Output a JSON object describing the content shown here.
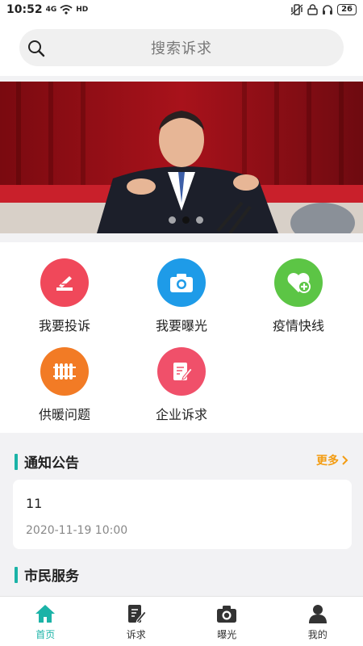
{
  "status_bar": {
    "time": "10:52",
    "network": "4G",
    "hd": "HD",
    "battery": "26"
  },
  "search": {
    "placeholder": "搜索诉求"
  },
  "banner": {
    "dots": 3,
    "active_dot": 1
  },
  "menu": [
    {
      "label": "我要投诉",
      "icon": "complaint-icon",
      "color": "#f0485a"
    },
    {
      "label": "我要曝光",
      "icon": "camera-icon",
      "color": "#1e9be8"
    },
    {
      "label": "疫情快线",
      "icon": "heart-plus-icon",
      "color": "#5cc545"
    },
    {
      "label": "供暖问题",
      "icon": "radiator-icon",
      "color": "#f27b25"
    },
    {
      "label": "企业诉求",
      "icon": "edit-icon",
      "color": "#f0506a"
    }
  ],
  "notice": {
    "section_title": "通知公告",
    "more_label": "更多",
    "items": [
      {
        "title": "11",
        "time": "2020-11-19 10:00"
      }
    ]
  },
  "services": {
    "section_title": "市民服务"
  },
  "tabs": [
    {
      "label": "首页",
      "icon": "home-icon",
      "active": true
    },
    {
      "label": "诉求",
      "icon": "edit-doc-icon",
      "active": false
    },
    {
      "label": "曝光",
      "icon": "camera-icon",
      "active": false
    },
    {
      "label": "我的",
      "icon": "user-icon",
      "active": false
    }
  ],
  "colors": {
    "accent": "#1bb3a7",
    "more": "#f39c12"
  }
}
